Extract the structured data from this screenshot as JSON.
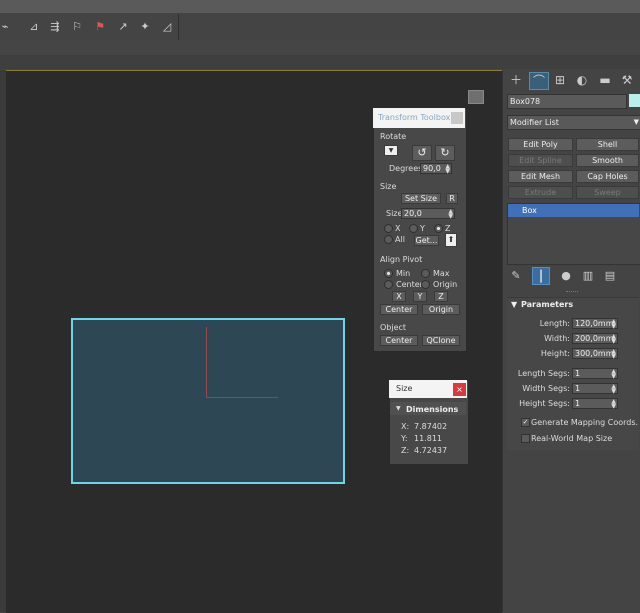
{
  "toolbar": {
    "icons": [
      "select-link-icon",
      "unlink-icon",
      "bind-space-warp-icon",
      "select-filter-icon",
      "snap-toggle-icon",
      "angle-snap-icon",
      "percent-snap-icon",
      "spinner-snap-icon"
    ]
  },
  "command_panel": {
    "object_name": "Box078",
    "object_color": "#b9f0ee",
    "modifier_list_label": "Modifier List",
    "quick_buttons": [
      {
        "label": "Edit Poly",
        "enabled": true
      },
      {
        "label": "Shell",
        "enabled": true
      },
      {
        "label": "Edit Spline",
        "enabled": false
      },
      {
        "label": "Smooth",
        "enabled": true
      },
      {
        "label": "Edit Mesh",
        "enabled": true
      },
      {
        "label": "Cap Holes",
        "enabled": true
      },
      {
        "label": "Extrude",
        "enabled": false
      },
      {
        "label": "Sweep",
        "enabled": false
      }
    ],
    "stack_selected": "Box",
    "parameters": {
      "title": "Parameters",
      "length_label": "Length:",
      "length": "120,0mm",
      "width_label": "Width:",
      "width": "200,0mm",
      "height_label": "Height:",
      "height": "300,0mm",
      "length_segs_label": "Length Segs:",
      "length_segs": "1",
      "width_segs_label": "Width Segs:",
      "width_segs": "1",
      "height_segs_label": "Height Segs:",
      "height_segs": "1",
      "gen_mapping_label": "Generate Mapping Coords.",
      "gen_mapping_checked": true,
      "real_world_label": "Real-World Map Size",
      "real_world_checked": false
    }
  },
  "transform_toolbox": {
    "title": "Transform Toolbox",
    "rotate_label": "Rotate",
    "degrees_label": "Degrees:",
    "degrees_value": "90,0",
    "size_section": "Size",
    "set_size_label": "Set Size",
    "r_label": "R",
    "size_label": "Size",
    "size_value": "20,0",
    "x_label": "X",
    "y_label": "Y",
    "z_label": "Z",
    "all_label": "All",
    "get_label": "Get...",
    "align_pivot_label": "Align Pivot",
    "min_label": "Min",
    "max_label": "Max",
    "center_label": "Center",
    "origin_label": "Origin",
    "ax_x": "X",
    "ax_y": "Y",
    "ax_z": "Z",
    "center_btn": "Center",
    "origin_btn": "Origin",
    "object_label": "Object",
    "obj_center_btn": "Center",
    "qclone_btn": "QClone"
  },
  "size_dialog": {
    "title": "Size",
    "close_label": "×",
    "section": "Dimensions",
    "x_label": "X:",
    "x": "7.87402",
    "y_label": "Y:",
    "y": "11.811",
    "z_label": "Z:",
    "z": "4.72437"
  }
}
